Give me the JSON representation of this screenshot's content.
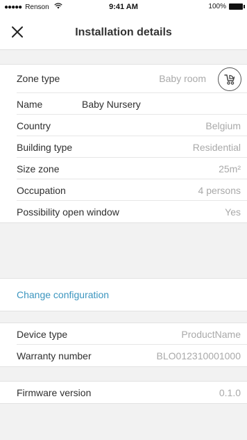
{
  "status_bar": {
    "dots": "●●●●●",
    "carrier": "Renson",
    "time": "9:41 AM",
    "battery_text": "100%"
  },
  "navbar": {
    "title": "Installation details",
    "close_icon": "close-icon"
  },
  "zone": {
    "zone_type_label": "Zone type",
    "zone_type_value": "Baby room",
    "zone_icon": "stroller-icon",
    "name_label": "Name",
    "name_value": "Baby Nursery",
    "country_label": "Country",
    "country_value": "Belgium",
    "building_label": "Building type",
    "building_value": "Residential",
    "size_label": "Size zone",
    "size_value": "25m²",
    "occupation_label": "Occupation",
    "occupation_value": "4 persons",
    "window_label": "Possibility open window",
    "window_value": "Yes"
  },
  "change_configuration": "Change configuration",
  "device": {
    "device_type_label": "Device type",
    "device_type_value": "ProductName",
    "warranty_label": "Warranty number",
    "warranty_value": "BLO012310001000"
  },
  "firmware": {
    "label": "Firmware version",
    "value": "0.1.0"
  },
  "colors": {
    "link": "#3b95bf",
    "background": "#f2f2f2",
    "value_text": "#a9a9a9"
  }
}
